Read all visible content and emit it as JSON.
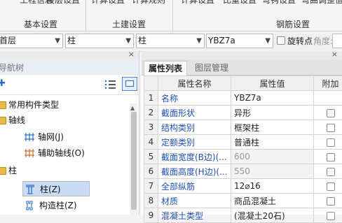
{
  "ribbon": {
    "top_items": [
      "工程信息",
      "楼层设置",
      "计算设置",
      "计算规则",
      "计算设置",
      "比重设置",
      "弯钩设置",
      "弯曲调整值"
    ],
    "groups": [
      "基本设置",
      "土建设置",
      "钢筋设置"
    ]
  },
  "selector_bar": {
    "floor": "首层",
    "category": "柱",
    "type": "柱",
    "component": "YBZ7a",
    "rotate_label": "旋转点",
    "angle_label": "角度:"
  },
  "nav": {
    "title": "导航树",
    "items": [
      {
        "label": "常用构件类型",
        "kind": "folder"
      },
      {
        "label": "轴线",
        "kind": "folder"
      },
      {
        "label": "轴网(J)",
        "kind": "axis-grid"
      },
      {
        "label": "辅助轴线(O)",
        "kind": "aux-axis"
      },
      {
        "label": "柱",
        "kind": "folder"
      },
      {
        "label": "柱(Z)",
        "kind": "column",
        "selected": true
      },
      {
        "label": "构造柱(Z)",
        "kind": "constructional-column"
      }
    ]
  },
  "props": {
    "tabs": [
      "属性列表",
      "图层管理"
    ],
    "columns": [
      "属性名称",
      "属性值",
      "附加"
    ],
    "rows": [
      {
        "idx": "1",
        "name": "名称",
        "value": "YBZ7a",
        "add": false
      },
      {
        "idx": "2",
        "name": "截面形状",
        "value": "异形",
        "add": true
      },
      {
        "idx": "3",
        "name": "结构类别",
        "value": "框架柱",
        "add": true
      },
      {
        "idx": "4",
        "name": "定额类别",
        "value": "普通柱",
        "add": true
      },
      {
        "idx": "5",
        "name": "截面宽度(B边)(...",
        "value": "600",
        "add": true,
        "disabled": true
      },
      {
        "idx": "6",
        "name": "截面高度(H边)(...",
        "value": "550",
        "add": true,
        "disabled": true
      },
      {
        "idx": "7",
        "name": "全部纵筋",
        "value": "12⌀16",
        "add": true
      },
      {
        "idx": "8",
        "name": "材质",
        "value": "商品混凝土",
        "add": true
      },
      {
        "idx": "9",
        "name": "混凝土类型",
        "value": "(混凝土20石)",
        "add": true
      }
    ]
  },
  "colors": {
    "accent": "#1f4fb8",
    "selection": "#c9dcf3"
  }
}
